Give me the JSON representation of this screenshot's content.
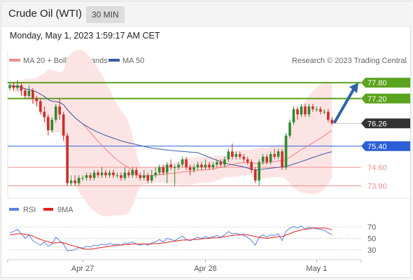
{
  "header": {
    "title": "Crude Oil (WTI)",
    "timeframe": "30 MIN",
    "timestamp": "Monday, May 1, 2023 1:59:17 AM CET"
  },
  "legend": {
    "ma20": "MA 20 + Bollinger Bands",
    "ma50": "MA 50",
    "credit": "Research © 2023 Trading Central",
    "rsi": "RSI",
    "rsi_ma": "9MA"
  },
  "colors": {
    "resistance": "#5aa31c",
    "support": "#f08e8e",
    "pivot": "#2c5fd6",
    "current": "#333333",
    "ma20": "#f08080",
    "ma50": "#3a5aa8",
    "bollinger": "#fde4e4",
    "candle_up": "#2f8a2f",
    "candle_down": "#c9302c",
    "arrow": "#2e63a8",
    "rsi": "#5a82e0",
    "rsi_ma": "#e02020"
  },
  "chart_data": [
    {
      "type": "candlestick",
      "instrument": "Crude Oil (WTI)",
      "interval": "30 MIN",
      "y_range": [
        73.7,
        78.2
      ],
      "price_levels": [
        {
          "label": "77.80",
          "value": 77.8,
          "kind": "resistance"
        },
        {
          "label": "77.20",
          "value": 77.2,
          "kind": "resistance"
        },
        {
          "label": "76.26",
          "value": 76.26,
          "kind": "current"
        },
        {
          "label": "75.40",
          "value": 75.4,
          "kind": "pivot"
        },
        {
          "label": "74.60",
          "value": 74.6,
          "kind": "support"
        },
        {
          "label": "73.90",
          "value": 73.9,
          "kind": "support"
        }
      ],
      "x_tick_labels": [
        {
          "label": "Apr 27",
          "index": 19
        },
        {
          "label": "Apr 28",
          "index": 51
        },
        {
          "label": "May 1",
          "index": 80
        }
      ],
      "candles": [
        [
          77.6,
          77.7,
          77.8,
          77.5
        ],
        [
          77.7,
          77.6,
          77.8,
          77.5
        ],
        [
          77.6,
          77.7,
          77.9,
          77.5
        ],
        [
          77.7,
          77.5,
          77.8,
          77.3
        ],
        [
          77.5,
          77.3,
          77.6,
          77.2
        ],
        [
          77.3,
          77.5,
          77.7,
          77.2
        ],
        [
          77.5,
          77.2,
          77.6,
          77.0
        ],
        [
          77.2,
          77.1,
          77.3,
          76.9
        ],
        [
          77.1,
          76.7,
          77.2,
          76.6
        ],
        [
          76.7,
          76.5,
          76.9,
          76.3
        ],
        [
          76.5,
          76.0,
          76.6,
          75.8
        ],
        [
          76.0,
          76.4,
          76.5,
          75.9
        ],
        [
          76.4,
          76.9,
          77.0,
          76.3
        ],
        [
          76.9,
          76.6,
          77.2,
          76.4
        ],
        [
          76.6,
          75.8,
          76.7,
          75.6
        ],
        [
          75.8,
          74.0,
          75.9,
          73.9
        ],
        [
          74.0,
          74.1,
          74.3,
          73.9
        ],
        [
          74.1,
          74.0,
          74.3,
          73.9
        ],
        [
          74.0,
          74.2,
          74.3,
          73.9
        ],
        [
          74.2,
          74.2,
          74.3,
          74.1
        ],
        [
          74.2,
          74.3,
          74.4,
          74.1
        ],
        [
          74.3,
          74.2,
          74.4,
          74.1
        ],
        [
          74.2,
          74.4,
          74.5,
          74.1
        ],
        [
          74.4,
          74.3,
          74.5,
          74.2
        ],
        [
          74.3,
          74.4,
          74.6,
          74.2
        ],
        [
          74.4,
          74.3,
          74.5,
          74.2
        ],
        [
          74.3,
          74.4,
          74.5,
          74.2
        ],
        [
          74.4,
          74.3,
          74.5,
          74.2
        ],
        [
          74.3,
          74.3,
          74.4,
          74.2
        ],
        [
          74.3,
          74.2,
          74.4,
          74.1
        ],
        [
          74.2,
          74.4,
          74.6,
          74.1
        ],
        [
          74.4,
          74.3,
          74.5,
          74.2
        ],
        [
          74.3,
          74.5,
          74.6,
          74.2
        ],
        [
          74.5,
          74.3,
          74.6,
          74.2
        ],
        [
          74.3,
          74.2,
          74.4,
          74.1
        ],
        [
          74.2,
          74.3,
          74.5,
          74.1
        ],
        [
          74.3,
          74.1,
          74.4,
          74.0
        ],
        [
          74.1,
          74.3,
          74.5,
          74.0
        ],
        [
          74.3,
          74.4,
          74.6,
          74.2
        ],
        [
          74.4,
          74.6,
          74.7,
          74.3
        ],
        [
          74.6,
          74.4,
          74.7,
          74.3
        ],
        [
          74.4,
          74.7,
          74.8,
          74.0
        ],
        [
          74.7,
          74.6,
          74.9,
          74.5
        ],
        [
          74.6,
          74.6,
          74.7,
          73.9
        ],
        [
          74.6,
          74.7,
          74.8,
          74.5
        ],
        [
          74.7,
          74.9,
          75.0,
          74.6
        ],
        [
          74.9,
          74.6,
          75.0,
          74.5
        ],
        [
          74.6,
          74.5,
          74.7,
          74.3
        ],
        [
          74.5,
          74.6,
          74.7,
          74.4
        ],
        [
          74.6,
          74.7,
          74.8,
          74.5
        ],
        [
          74.7,
          74.6,
          74.8,
          74.5
        ],
        [
          74.6,
          74.7,
          74.9,
          74.5
        ],
        [
          74.7,
          74.6,
          74.8,
          74.5
        ],
        [
          74.6,
          74.7,
          74.8,
          74.5
        ],
        [
          74.7,
          74.8,
          74.9,
          74.6
        ],
        [
          74.8,
          74.7,
          74.9,
          74.6
        ],
        [
          74.7,
          74.9,
          75.0,
          74.6
        ],
        [
          74.9,
          75.2,
          75.3,
          74.8
        ],
        [
          75.2,
          75.0,
          75.5,
          74.9
        ],
        [
          75.0,
          75.1,
          75.2,
          74.9
        ],
        [
          75.1,
          75.0,
          75.2,
          74.9
        ],
        [
          75.0,
          74.9,
          75.1,
          74.8
        ],
        [
          74.9,
          74.8,
          75.0,
          74.7
        ],
        [
          74.8,
          74.5,
          74.9,
          74.4
        ],
        [
          74.5,
          74.1,
          74.6,
          74.0
        ],
        [
          74.1,
          74.8,
          74.9,
          73.9
        ],
        [
          74.8,
          75.0,
          75.1,
          74.7
        ],
        [
          75.0,
          74.8,
          75.1,
          74.7
        ],
        [
          74.8,
          75.1,
          75.2,
          74.7
        ],
        [
          75.1,
          75.0,
          75.3,
          74.9
        ],
        [
          75.0,
          75.2,
          75.3,
          74.9
        ],
        [
          75.2,
          74.6,
          75.3,
          74.5
        ],
        [
          74.6,
          75.8,
          75.9,
          74.5
        ],
        [
          75.8,
          76.3,
          76.4,
          75.7
        ],
        [
          76.3,
          76.8,
          76.9,
          76.2
        ],
        [
          76.8,
          76.6,
          76.9,
          76.4
        ],
        [
          76.6,
          76.9,
          77.0,
          76.5
        ],
        [
          76.9,
          76.6,
          77.0,
          76.5
        ],
        [
          76.6,
          76.9,
          77.0,
          76.5
        ],
        [
          76.9,
          76.8,
          77.0,
          76.7
        ],
        [
          76.8,
          76.8,
          76.9,
          76.7
        ],
        [
          76.8,
          76.7,
          76.9,
          76.6
        ],
        [
          76.7,
          76.7,
          76.8,
          76.6
        ],
        [
          76.7,
          76.4,
          76.8,
          76.3
        ],
        [
          76.4,
          76.26,
          76.5,
          76.2
        ]
      ],
      "forecast_arrow": {
        "from": 76.26,
        "to": 77.8
      }
    },
    {
      "type": "line",
      "title": "RSI",
      "y_range": [
        15,
        85
      ],
      "ticks": [
        30,
        50,
        70
      ],
      "series": [
        {
          "name": "RSI",
          "values": [
            60,
            62,
            66,
            58,
            50,
            56,
            46,
            42,
            38,
            44,
            36,
            40,
            52,
            46,
            40,
            28,
            29,
            30,
            34,
            33,
            36,
            35,
            38,
            37,
            40,
            38,
            41,
            39,
            40,
            38,
            42,
            41,
            44,
            40,
            38,
            41,
            38,
            42,
            44,
            48,
            44,
            50,
            48,
            46,
            50,
            54,
            48,
            46,
            49,
            52,
            50,
            53,
            51,
            53,
            55,
            52,
            56,
            62,
            58,
            59,
            57,
            55,
            52,
            46,
            38,
            52,
            56,
            52,
            56,
            55,
            58,
            46,
            62,
            68,
            71,
            68,
            72,
            66,
            70,
            68,
            67,
            66,
            64,
            60,
            56
          ]
        },
        {
          "name": "9MA",
          "values": [
            56,
            57,
            58,
            58,
            57,
            56,
            54,
            51,
            48,
            46,
            44,
            42,
            42,
            43,
            42,
            40,
            38,
            36,
            34,
            32,
            31,
            31,
            32,
            33,
            34,
            35,
            36,
            37,
            38,
            38,
            39,
            39,
            40,
            40,
            40,
            40,
            40,
            40,
            41,
            41,
            42,
            43,
            44,
            45,
            46,
            47,
            47,
            47,
            48,
            48,
            49,
            50,
            50,
            51,
            51,
            52,
            53,
            54,
            55,
            56,
            56,
            57,
            56,
            55,
            53,
            52,
            51,
            50,
            51,
            52,
            53,
            53,
            56,
            58,
            61,
            63,
            65,
            66,
            67,
            68,
            68,
            68,
            68,
            67,
            65
          ]
        }
      ]
    }
  ]
}
